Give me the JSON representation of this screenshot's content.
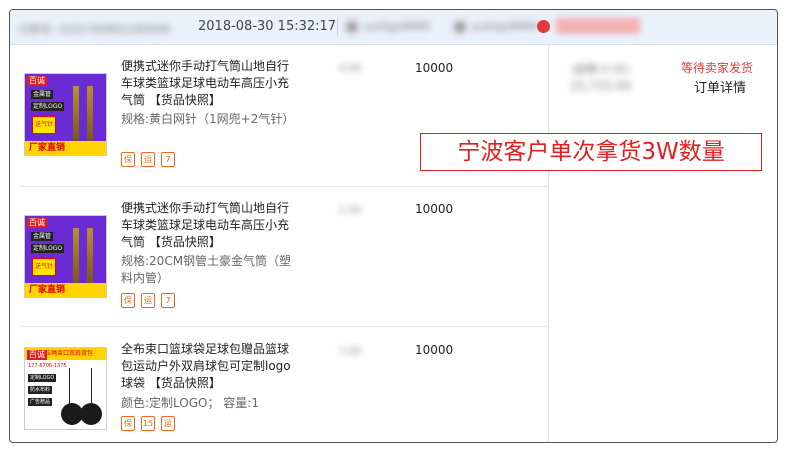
{
  "header": {
    "order_label": "订单号",
    "order_no": "2101784861185949",
    "datetime": "2018-08-30 15:32:17",
    "buyer_name": "yuhtgs9999",
    "seller_name": "yuhtgs9999",
    "chat_label": "和我联系"
  },
  "items": [
    {
      "title": "便携式迷你手动打气筒山地自行车球类篮球足球电动车高压小充气筒 【货品快照】",
      "spec": "规格:黄白网针（1网兜+2气针）",
      "price": "0.00",
      "quantity": "10000",
      "icons": [
        "guarantee-icon",
        "delivery-icon",
        "seven-day-return-icon"
      ],
      "thumb_texts": {
        "brand": "百诚",
        "tag1": "金属管",
        "tag2": "定制LOGO",
        "sticker": "送气针",
        "banner": "厂家直销"
      }
    },
    {
      "title": "便携式迷你手动打气筒山地自行车球类篮球足球电动车高压小充气筒 【货品快照】",
      "spec": "规格:20CM钢管土豪金气筒（塑料内管）",
      "price": "1.00",
      "quantity": "10000",
      "icons": [
        "guarantee-icon",
        "delivery-icon",
        "seven-day-return-icon"
      ],
      "thumb_texts": {
        "brand": "百诚",
        "tag1": "金属管",
        "tag2": "定制LOGO",
        "sticker": "送气针",
        "banner": "厂家直销"
      }
    },
    {
      "title": "全布束口篮球袋足球包赠品篮球包运动户外双肩球包可定制logo球袋 【货品快照】",
      "spec": "颜色:定制LOGO； 容量:1",
      "price": "1.00",
      "quantity": "10000",
      "icons": [
        "guarantee-icon",
        "fifteen-day-return-icon",
        "delivery-icon"
      ],
      "thumb_texts": {
        "brand": "百诚",
        "topbar": "拉绳束口双肩背包",
        "phone": "177-6706-1375",
        "t1": "定制LOGO",
        "t2": "防水布料",
        "t3": "广告赠品"
      }
    }
  ],
  "icon_glyphs": {
    "guarantee-icon": "保",
    "delivery-icon": "运",
    "seven-day-return-icon": "7",
    "fifteen-day-return-icon": "15"
  },
  "summary": {
    "status": "等待卖家发货",
    "detail_link": "订单详情",
    "shipping": "(邮费:0.00)",
    "total": "25,733.00"
  },
  "annotation": "宁波客户单次拿货3W数量",
  "colors": {
    "header_bg": "#e9f1fb",
    "status_red": "#e4393c",
    "icon_orange": "#ec6a1f",
    "annotation_red": "#e02020"
  }
}
